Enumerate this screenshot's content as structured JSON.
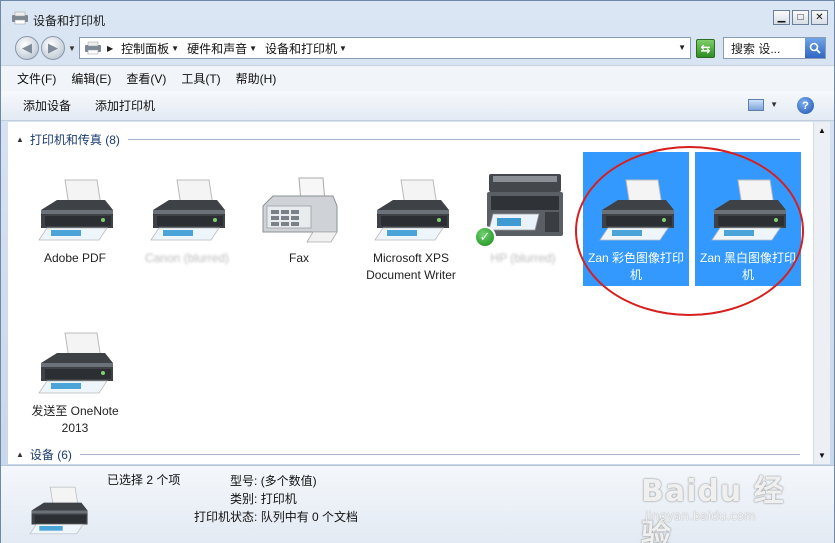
{
  "window": {
    "title": "设备和打印机"
  },
  "address": {
    "crumbs": [
      "控制面板",
      "硬件和声音",
      "设备和打印机"
    ]
  },
  "search": {
    "placeholder": "搜索 设..."
  },
  "menu": {
    "items": [
      "文件(F)",
      "编辑(E)",
      "查看(V)",
      "工具(T)",
      "帮助(H)"
    ]
  },
  "commands": {
    "add_device": "添加设备",
    "add_printer": "添加打印机"
  },
  "groups": {
    "printers": "打印机和传真 (8)",
    "devices": "设备 (6)"
  },
  "devices": [
    {
      "label": "Adobe PDF",
      "selected": false,
      "icon": "printer-icon"
    },
    {
      "label": "Canon (blurred)",
      "selected": false,
      "icon": "printer-icon",
      "obscured": true
    },
    {
      "label": "Fax",
      "selected": false,
      "icon": "fax-icon"
    },
    {
      "label": "Microsoft XPS Document Writer",
      "selected": false,
      "icon": "printer-icon"
    },
    {
      "label": "HP (blurred)",
      "selected": false,
      "icon": "mfp-printer-icon",
      "obscured": true,
      "default": true
    },
    {
      "label": "Zan 彩色图像打印机",
      "selected": true,
      "icon": "printer-icon"
    },
    {
      "label": "Zan 黑白图像打印机",
      "selected": true,
      "icon": "printer-icon"
    },
    {
      "label": "发送至 OneNote 2013",
      "selected": false,
      "icon": "printer-icon"
    }
  ],
  "details": {
    "selected_text": "已选择 2 个项",
    "model_key": "型号:",
    "model_val": "(多个数值)",
    "category_key": "类别:",
    "category_val": "打印机",
    "status_key": "打印机状态:",
    "status_val": "队列中有 0 个文档"
  },
  "watermark": {
    "main": "Baidu 经验",
    "sub": "jingyan.baidu.com"
  },
  "colors": {
    "selection": "#3399ff",
    "annotation_ring": "#d62020",
    "group_text": "#1a3c6e"
  }
}
